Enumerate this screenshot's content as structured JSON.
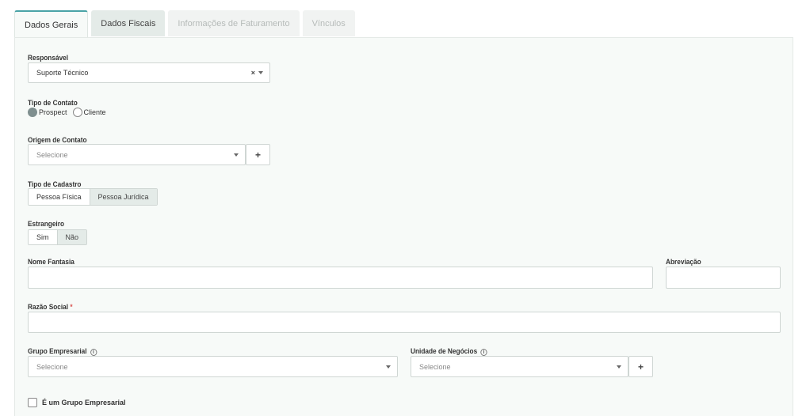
{
  "tabs": [
    {
      "label": "Dados Gerais",
      "state": "active"
    },
    {
      "label": "Dados Fiscais",
      "state": "normal"
    },
    {
      "label": "Informações de Faturamento",
      "state": "disabled"
    },
    {
      "label": "Vínculos",
      "state": "disabled"
    }
  ],
  "responsavel": {
    "label": "Responsável",
    "value": "Suporte Técnico",
    "clear": "×"
  },
  "tipo_contato": {
    "label": "Tipo de Contato",
    "options": [
      "Prospect",
      "Cliente"
    ],
    "selected": "Prospect"
  },
  "origem_contato": {
    "label": "Origem de Contato",
    "placeholder": "Selecione",
    "add": "+"
  },
  "tipo_cadastro": {
    "label": "Tipo de Cadastro",
    "options": [
      "Pessoa Física",
      "Pessoa Jurídica"
    ],
    "selected": "Pessoa Física"
  },
  "estrangeiro": {
    "label": "Estrangeiro",
    "options": [
      "Sim",
      "Não"
    ],
    "selected": "Sim"
  },
  "nome_fantasia": {
    "label": "Nome Fantasia",
    "value": ""
  },
  "abreviacao": {
    "label": "Abreviação",
    "value": ""
  },
  "razao_social": {
    "label": "Razão Social",
    "required": "*",
    "value": ""
  },
  "grupo_empresarial": {
    "label": "Grupo Empresarial",
    "placeholder": "Selecione",
    "info": "i"
  },
  "unidade_negocios": {
    "label": "Unidade de Negócios",
    "placeholder": "Selecione",
    "info": "i",
    "add": "+"
  },
  "is_grupo": {
    "label": "É um Grupo Empresarial",
    "checked": false
  },
  "colors": {
    "accent": "#4aa3a6",
    "panel": "#f7faf8",
    "tab_bg": "#e4ebe8",
    "radio_on": "#7f8f8f",
    "required": "#d9534f"
  }
}
